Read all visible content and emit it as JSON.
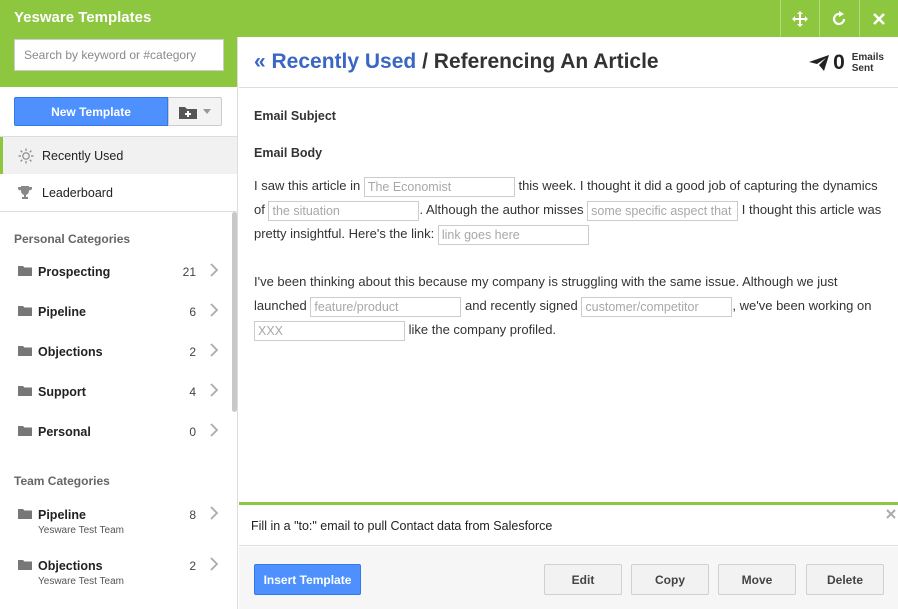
{
  "window": {
    "title": "Yesware Templates"
  },
  "search": {
    "placeholder": "Search by keyword or #category"
  },
  "sidebar": {
    "new_template_label": "New Template",
    "nav": [
      {
        "label": "Recently Used",
        "icon": "sun-icon"
      },
      {
        "label": "Leaderboard",
        "icon": "trophy-icon"
      }
    ],
    "personal_header": "Personal Categories",
    "personal": [
      {
        "name": "Prospecting",
        "count": "21"
      },
      {
        "name": "Pipeline",
        "count": "6"
      },
      {
        "name": "Objections",
        "count": "2"
      },
      {
        "name": "Support",
        "count": "4"
      },
      {
        "name": "Personal",
        "count": "0"
      }
    ],
    "team_header": "Team Categories",
    "team": [
      {
        "name": "Pipeline",
        "count": "8",
        "team": "Yesware Test Team"
      },
      {
        "name": "Objections",
        "count": "2",
        "team": "Yesware Test Team"
      }
    ]
  },
  "header": {
    "back_link": "« Recently Used",
    "separator": "/",
    "title": "Referencing An Article",
    "sent_count": "0",
    "sent_label_1": "Emails",
    "sent_label_2": "Sent"
  },
  "email": {
    "subject_label": "Email Subject",
    "body_label": "Email Body",
    "p1_a": "I saw this article in",
    "f1": "The Economist",
    "p1_b": "this week. I thought it did a good job of capturing the dynamics of",
    "f2": "the situation",
    "p1_c": ". Although the author misses",
    "f3": "some specific aspect that",
    "p1_d": "I thought this article was pretty insightful. Here's the link:",
    "f4": "link goes here",
    "p2_a": "I've been thinking about this because my company is struggling with the same issue. Although we just launched",
    "f5": "feature/product",
    "p2_b": "and recently signed",
    "f6": "customer/competitor",
    "p2_c": ", we've been working on",
    "f7": "XXX",
    "p2_d": "like the company profiled."
  },
  "salesforce": {
    "message": "Fill in a \"to:\" email to pull Contact data from Salesforce"
  },
  "actions": {
    "insert": "Insert Template",
    "edit": "Edit",
    "copy": "Copy",
    "move": "Move",
    "delete": "Delete"
  },
  "colors": {
    "brand": "#8dc63f",
    "primary": "#4d90fe",
    "link": "#3b67c4"
  }
}
